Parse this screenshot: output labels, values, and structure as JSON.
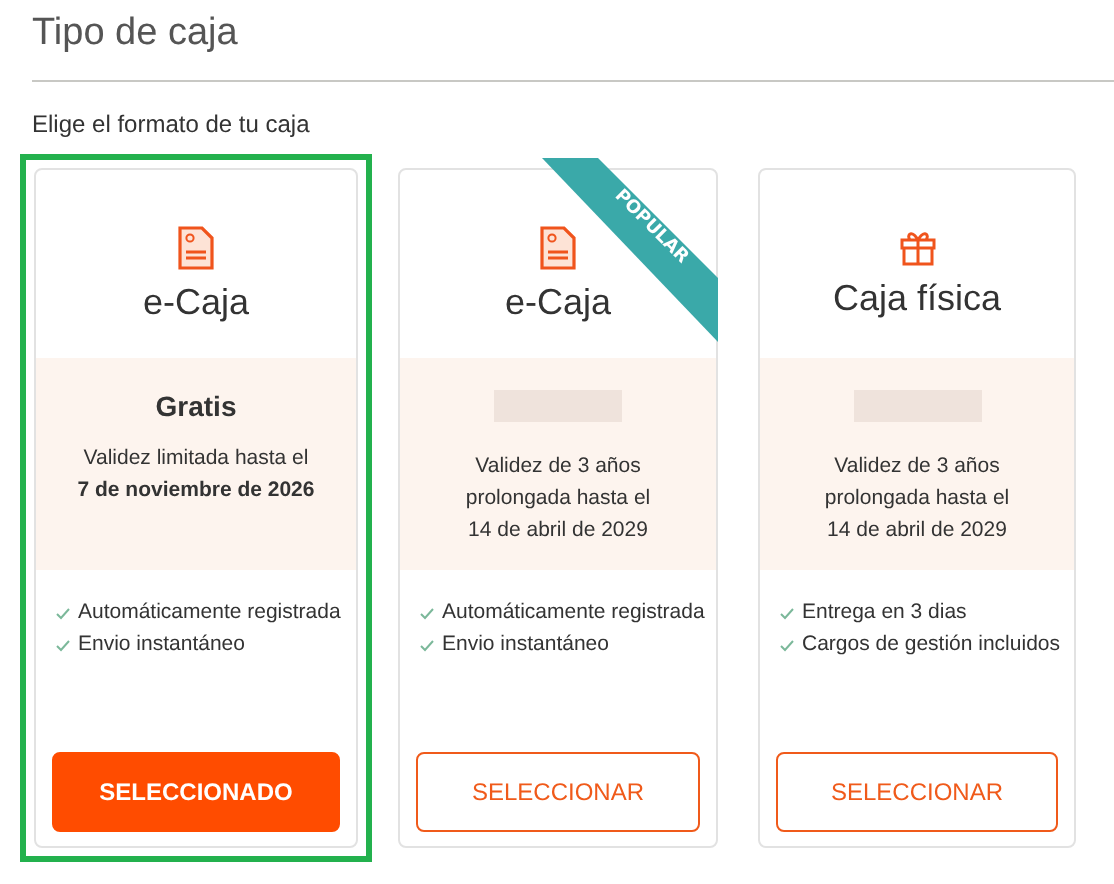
{
  "title": "Tipo de caja",
  "subtitle": "Elige el formato de tu caja",
  "cards": [
    {
      "kind": "document",
      "name": "e-Caja",
      "selected": true,
      "price": "Gratis",
      "validity": "Validez limitada hasta el",
      "date": "7 de noviembre de 2026",
      "date_bold": true,
      "features": [
        "Automáticamente registrada",
        "Envio instantáneo"
      ],
      "button": "SELECCIONADO"
    },
    {
      "kind": "document",
      "name": "e-Caja",
      "selected": false,
      "badge": "POPULAR",
      "price_hidden": true,
      "validity": "Validez de 3 años prolongada hasta el",
      "date": "14 de abril de 2029",
      "date_bold": false,
      "features": [
        "Automáticamente registrada",
        "Envio instantáneo"
      ],
      "button": "SELECCIONAR"
    },
    {
      "kind": "gift",
      "name": "Caja física",
      "selected": false,
      "price_hidden": true,
      "validity": "Validez de 3 años prolongada hasta el",
      "date": "14 de abril de 2029",
      "date_bold": false,
      "features": [
        "Entrega en 3 dias",
        "Cargos de gestión incluidos"
      ],
      "button": "SELECCIONAR"
    }
  ]
}
